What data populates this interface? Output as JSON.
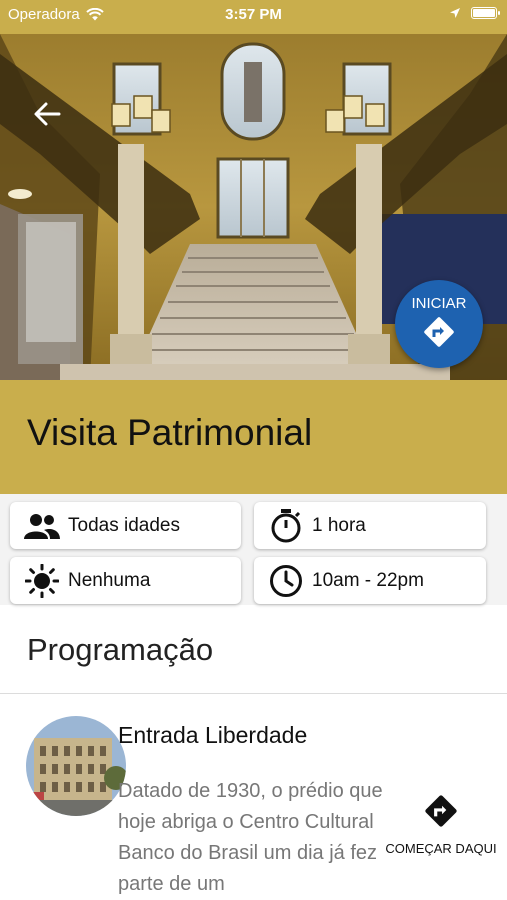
{
  "status_bar": {
    "carrier": "Operadora",
    "time": "3:57 PM"
  },
  "header": {
    "back_icon": "arrow-left-icon",
    "start_button_label": "INICIAR",
    "start_icon": "directions-icon"
  },
  "title": "Visita Patrimonial",
  "info": {
    "age": "Todas idades",
    "age_icon": "people-icon",
    "duration": "1 hora",
    "duration_icon": "stopwatch-icon",
    "weather": "Nenhuma",
    "weather_icon": "sun-icon",
    "hours": "10am - 22pm",
    "hours_icon": "clock-icon"
  },
  "programacao": {
    "heading": "Programação",
    "items": [
      {
        "title": "Entrada Liberdade",
        "description": "Datado de 1930, o prédio que hoje abriga o Centro Cultural Banco do Brasil um dia já fez parte de um",
        "action_label": "COMEÇAR DAQUI",
        "action_icon": "directions-icon"
      }
    ]
  },
  "colors": {
    "brand_gold": "#c9ae4c",
    "fab_blue": "#1e62b0"
  }
}
